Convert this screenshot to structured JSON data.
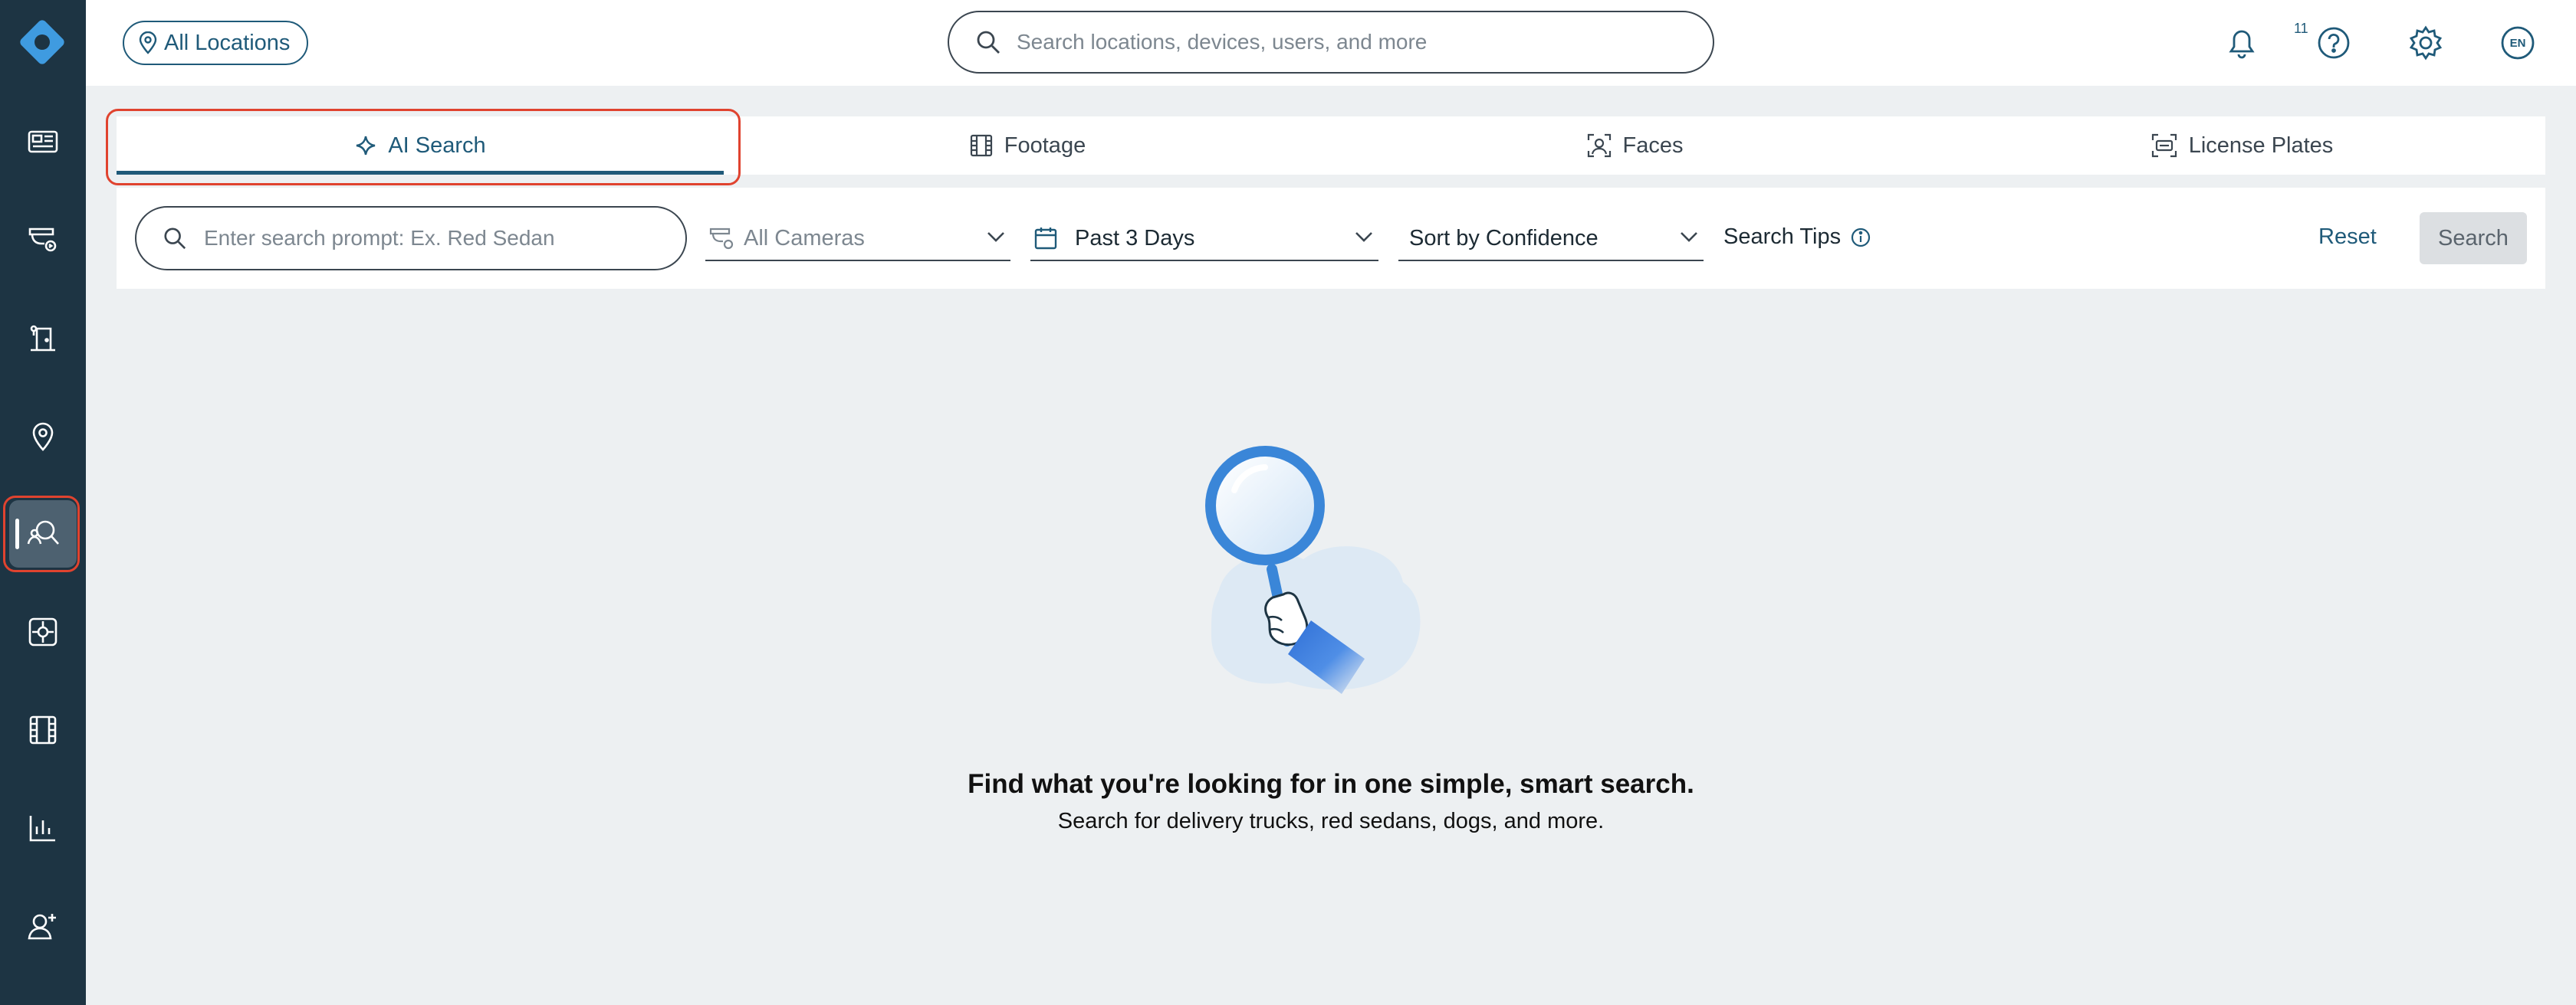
{
  "header": {
    "location_label": "All Locations",
    "search_placeholder": "Search locations, devices, users, and more",
    "notification_count": "11",
    "language": "EN"
  },
  "sidebar": {
    "items": [
      {
        "icon": "dashboard-icon"
      },
      {
        "icon": "cameras-icon"
      },
      {
        "icon": "access-control-icon"
      },
      {
        "icon": "locations-icon"
      },
      {
        "icon": "people-search-icon",
        "active": true
      },
      {
        "icon": "alarms-icon"
      },
      {
        "icon": "footage-icon"
      },
      {
        "icon": "analytics-icon"
      },
      {
        "icon": "add-user-icon"
      }
    ]
  },
  "tabs": [
    {
      "label": "AI Search",
      "icon": "sparkle-icon",
      "active": true
    },
    {
      "label": "Footage",
      "icon": "film-icon"
    },
    {
      "label": "Faces",
      "icon": "face-scan-icon"
    },
    {
      "label": "License Plates",
      "icon": "plate-scan-icon"
    }
  ],
  "filters": {
    "prompt_placeholder": "Enter search prompt: Ex. Red Sedan",
    "cameras": "All Cameras",
    "date_range": "Past 3 Days",
    "sort": "Sort by Confidence",
    "tips": "Search Tips",
    "reset": "Reset",
    "search": "Search"
  },
  "empty_state": {
    "title": "Find what you're looking for in one simple, smart search.",
    "subtitle": "Search for delivery trucks, red sedans, dogs, and more."
  },
  "colors": {
    "sidebar": "#1d3443",
    "accent": "#1f5a79",
    "highlight": "#e0432f",
    "background": "#edf0f2"
  }
}
